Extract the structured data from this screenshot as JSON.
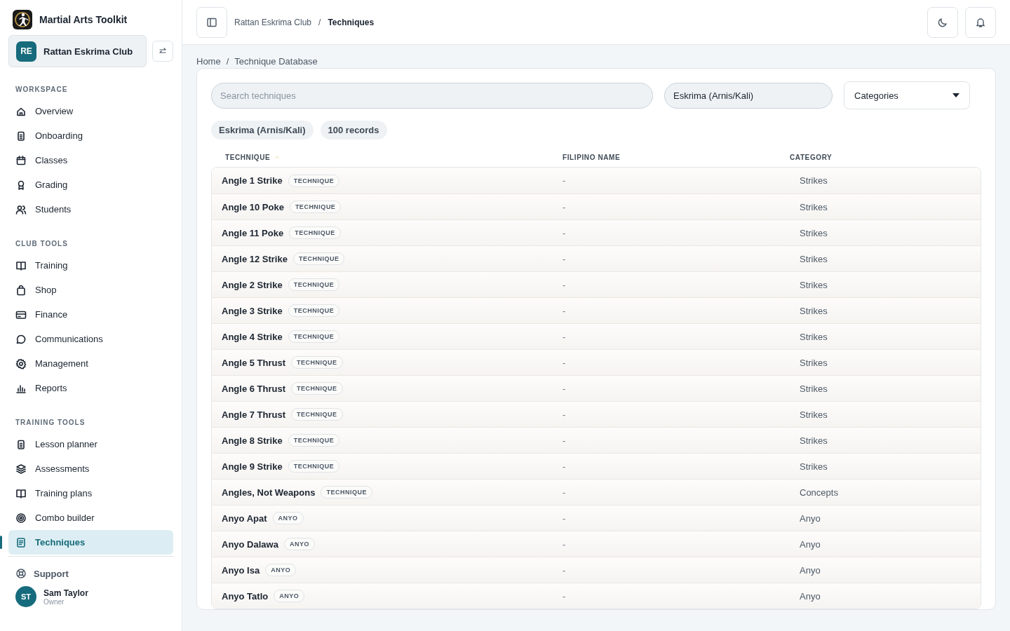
{
  "app": {
    "name": "Martial Arts Toolkit"
  },
  "club": {
    "initials": "RE",
    "name": "Rattan Eskrima Club"
  },
  "sidebar": {
    "sections": [
      {
        "title": "WORKSPACE",
        "items": [
          {
            "label": "Overview",
            "selected": false
          },
          {
            "label": "Onboarding",
            "selected": false
          },
          {
            "label": "Classes",
            "selected": false
          },
          {
            "label": "Grading",
            "selected": false
          },
          {
            "label": "Students",
            "selected": false
          }
        ]
      },
      {
        "title": "CLUB TOOLS",
        "items": [
          {
            "label": "Training",
            "selected": false
          },
          {
            "label": "Shop",
            "selected": false
          },
          {
            "label": "Finance",
            "selected": false
          },
          {
            "label": "Communications",
            "selected": false
          },
          {
            "label": "Management",
            "selected": false
          },
          {
            "label": "Reports",
            "selected": false
          }
        ]
      },
      {
        "title": "TRAINING TOOLS",
        "items": [
          {
            "label": "Lesson planner",
            "selected": false
          },
          {
            "label": "Assessments",
            "selected": false
          },
          {
            "label": "Training plans",
            "selected": false
          },
          {
            "label": "Combo builder",
            "selected": false
          },
          {
            "label": "Techniques",
            "selected": true
          }
        ]
      }
    ],
    "support": "Support",
    "user": {
      "initials": "ST",
      "name": "Sam Taylor",
      "role": "Owner"
    }
  },
  "topbar": {
    "breadcrumb": {
      "items": [
        "Rattan Eskrima Club",
        "Techniques"
      ],
      "separator": "/"
    }
  },
  "breadcrumb": {
    "items": [
      "Home",
      "Technique Database"
    ],
    "separator": "/"
  },
  "filters": {
    "search": {
      "placeholder": "Search techniques"
    },
    "style": {
      "value": "Eskrima (Arnis/Kali)"
    },
    "category": {
      "value": "Categories"
    }
  },
  "chips": [
    "Eskrima (Arnis/Kali)",
    "100 records"
  ],
  "table": {
    "columns": [
      "TECHNIQUE",
      "FILIPINO NAME",
      "CATEGORY"
    ],
    "rows": [
      {
        "name": "Angle 1 Strike",
        "tag": "TECHNIQUE",
        "filipino": "-",
        "category": "Strikes"
      },
      {
        "name": "Angle 10 Poke",
        "tag": "TECHNIQUE",
        "filipino": "-",
        "category": "Strikes"
      },
      {
        "name": "Angle 11 Poke",
        "tag": "TECHNIQUE",
        "filipino": "-",
        "category": "Strikes"
      },
      {
        "name": "Angle 12 Strike",
        "tag": "TECHNIQUE",
        "filipino": "-",
        "category": "Strikes"
      },
      {
        "name": "Angle 2 Strike",
        "tag": "TECHNIQUE",
        "filipino": "-",
        "category": "Strikes"
      },
      {
        "name": "Angle 3 Strike",
        "tag": "TECHNIQUE",
        "filipino": "-",
        "category": "Strikes"
      },
      {
        "name": "Angle 4 Strike",
        "tag": "TECHNIQUE",
        "filipino": "-",
        "category": "Strikes"
      },
      {
        "name": "Angle 5 Thrust",
        "tag": "TECHNIQUE",
        "filipino": "-",
        "category": "Strikes"
      },
      {
        "name": "Angle 6 Thrust",
        "tag": "TECHNIQUE",
        "filipino": "-",
        "category": "Strikes"
      },
      {
        "name": "Angle 7 Thrust",
        "tag": "TECHNIQUE",
        "filipino": "-",
        "category": "Strikes"
      },
      {
        "name": "Angle 8 Strike",
        "tag": "TECHNIQUE",
        "filipino": "-",
        "category": "Strikes"
      },
      {
        "name": "Angle 9 Strike",
        "tag": "TECHNIQUE",
        "filipino": "-",
        "category": "Strikes"
      },
      {
        "name": "Angles, Not Weapons",
        "tag": "TECHNIQUE",
        "filipino": "-",
        "category": "Concepts"
      },
      {
        "name": "Anyo Apat",
        "tag": "ANYO",
        "filipino": "-",
        "category": "Anyo"
      },
      {
        "name": "Anyo Dalawa",
        "tag": "ANYO",
        "filipino": "-",
        "category": "Anyo"
      },
      {
        "name": "Anyo Isa",
        "tag": "ANYO",
        "filipino": "-",
        "category": "Anyo"
      },
      {
        "name": "Anyo Tatlo",
        "tag": "ANYO",
        "filipino": "-",
        "category": "Anyo"
      }
    ]
  }
}
